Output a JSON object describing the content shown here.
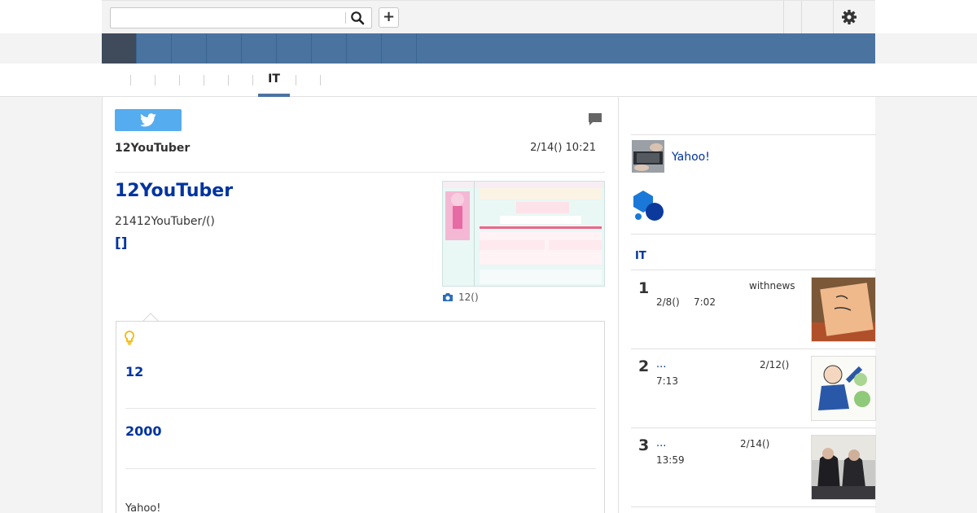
{
  "search": {
    "placeholder": "",
    "value": ""
  },
  "toolbar": {
    "add_label": "+"
  },
  "tabs": {
    "active_label": "IT"
  },
  "article": {
    "source": "12YouTuber",
    "datetime": "2/14() 10:21",
    "headline": "12YouTuber",
    "summary": "21412YouTuber/()",
    "bracket_link": "[]",
    "photo_caption": "12()"
  },
  "hints": [
    {
      "text": "12"
    },
    {
      "text": "2000"
    },
    {
      "text": "Yahoo!"
    }
  ],
  "sidebar": {
    "yahoo_link": "Yahoo!",
    "section_title": "IT",
    "ranking": [
      {
        "rank": "1",
        "source": "withnews",
        "date": "2/8()",
        "time": "7:02",
        "title": ""
      },
      {
        "rank": "2",
        "title": "...",
        "date": "2/12()",
        "time": "7:13",
        "source": ""
      },
      {
        "rank": "3",
        "title": "...",
        "date": "2/14()",
        "time": "13:59",
        "source": ""
      }
    ]
  },
  "colors": {
    "nav": "#4a73a0",
    "nav_active": "#3f4a5a",
    "link": "#0033a0",
    "twitter": "#55acee",
    "hint_bulb": "#f2b705"
  },
  "icons": {
    "search": "search-icon",
    "add": "plus-icon",
    "settings": "gear-icon",
    "twitter": "twitter-bird-icon",
    "comment": "comment-icon",
    "camera": "camera-icon",
    "hint": "lightbulb-icon"
  }
}
